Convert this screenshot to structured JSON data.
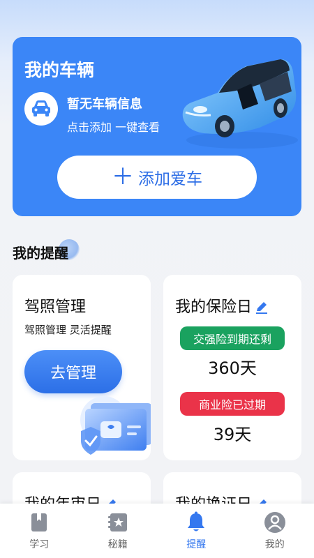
{
  "vehicle": {
    "title": "我的车辆",
    "no_info": "暂无车辆信息",
    "no_info_sub": "点击添加 一键查看",
    "add_button": "添加爱车"
  },
  "reminders": {
    "section_title": "我的提醒",
    "license": {
      "title": "驾照管理",
      "subtitle": "驾照管理 灵活提醒",
      "button": "去管理"
    },
    "insurance": {
      "title": "我的保险日",
      "compulsory_label": "交强险到期还剩",
      "compulsory_days": "360天",
      "commercial_label": "商业险已过期",
      "commercial_days": "39天"
    },
    "annual": {
      "title": "我的年审日"
    },
    "renew": {
      "title": "我的换证日"
    }
  },
  "nav": {
    "items": [
      {
        "label": "学习",
        "icon": "book-icon"
      },
      {
        "label": "秘籍",
        "icon": "cheat-book-icon"
      },
      {
        "label": "提醒",
        "icon": "bell-icon",
        "active": true
      },
      {
        "label": "我的",
        "icon": "profile-icon"
      }
    ]
  },
  "colors": {
    "primary": "#3b86f7",
    "active_nav": "#3578ef",
    "green_badge": "#1aa25f",
    "red_badge": "#ea3349"
  }
}
